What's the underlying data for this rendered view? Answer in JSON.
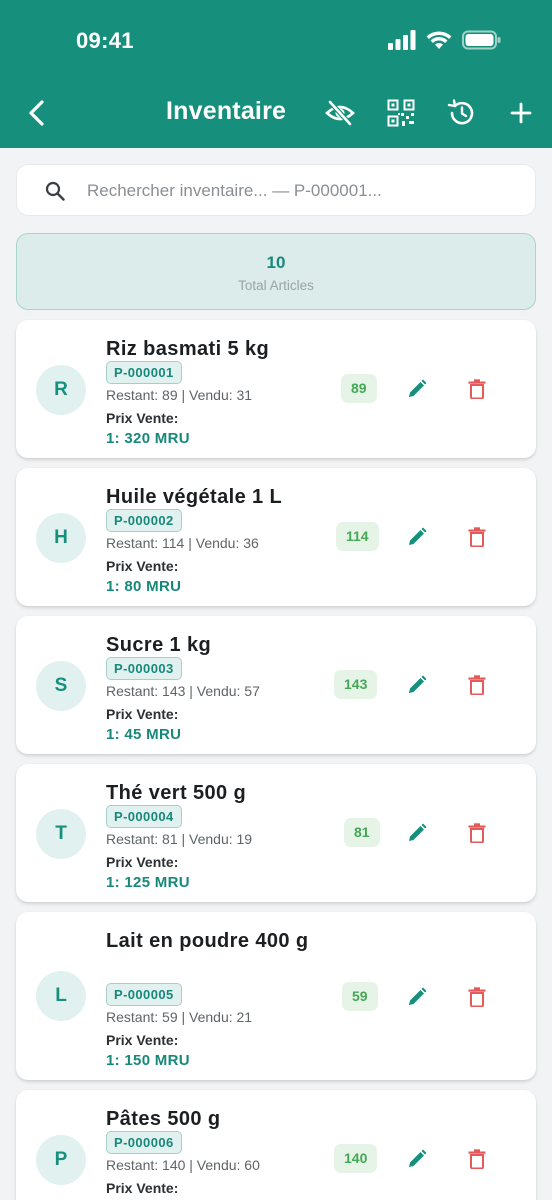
{
  "status_bar": {
    "time": "09:41"
  },
  "nav": {
    "title": "Inventaire",
    "actions": [
      "visibility-off-icon",
      "qr-code-icon",
      "history-icon",
      "add-icon"
    ]
  },
  "search": {
    "placeholder": "Rechercher inventaire... — P-000001..."
  },
  "summary": {
    "count": "10",
    "label": "Total Articles"
  },
  "colors": {
    "primary": "#16907c",
    "accent_text": "#17897a",
    "stock_green": "#45a856",
    "delete_red": "#e25a5a"
  },
  "products": [
    {
      "initial": "R",
      "name": "Riz basmati 5 kg",
      "sku": "P-000001",
      "stock": "Restant: 89 | Vendu: 31",
      "price_label": "Prix Vente:",
      "price": "1: 320 MRU",
      "qty": "89"
    },
    {
      "initial": "H",
      "name": "Huile végétale 1 L",
      "sku": "P-000002",
      "stock": "Restant: 114 | Vendu: 36",
      "price_label": "Prix Vente:",
      "price": "1: 80 MRU",
      "qty": "114"
    },
    {
      "initial": "S",
      "name": "Sucre 1 kg",
      "sku": "P-000003",
      "stock": "Restant: 143 | Vendu: 57",
      "price_label": "Prix Vente:",
      "price": "1: 45 MRU",
      "qty": "143"
    },
    {
      "initial": "T",
      "name": "Thé vert 500 g",
      "sku": "P-000004",
      "stock": "Restant: 81 | Vendu: 19",
      "price_label": "Prix Vente:",
      "price": "1: 125 MRU",
      "qty": "81"
    },
    {
      "initial": "L",
      "name": "Lait en poudre 400 g",
      "sku": "P-000005",
      "stock": "Restant: 59 | Vendu: 21",
      "price_label": "Prix Vente:",
      "price": "1: 150 MRU",
      "qty": "59"
    },
    {
      "initial": "P",
      "name": "Pâtes 500 g",
      "sku": "P-000006",
      "stock": "Restant: 140 | Vendu: 60",
      "price_label": "Prix Vente:",
      "price": "",
      "qty": "140"
    }
  ]
}
